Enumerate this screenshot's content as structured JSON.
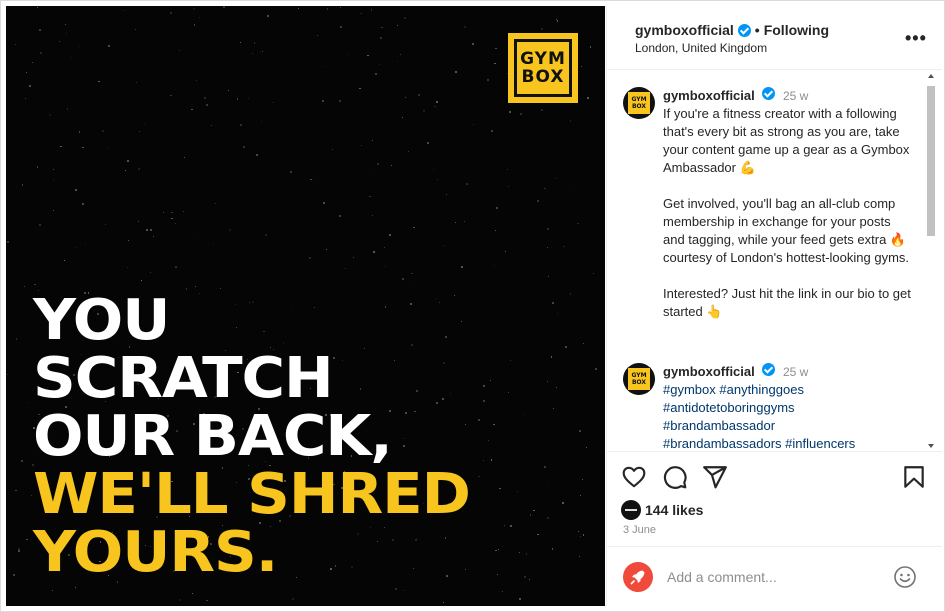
{
  "post": {
    "username": "gymboxofficial",
    "follow_status": "Following",
    "separator": "•",
    "location": "London, United Kingdom",
    "more_icon": "more-horizontal-icon",
    "more_glyph": "•••"
  },
  "media": {
    "logo_line1": "GYM",
    "logo_line2": "BOX",
    "headline": [
      "YOU",
      "SCRATCH",
      "OUR BACK,",
      "WE'LL SHRED",
      "YOURS."
    ],
    "colors": {
      "background": "#050505",
      "accent": "#f7c51e",
      "text": "#ffffff"
    }
  },
  "caption": {
    "username": "gymboxofficial",
    "time": "25 w",
    "text": "If you're a fitness creator with a following that's every bit as strong as you are, take your content game up a gear as a Gymbox Ambassador 💪\n\nGet involved, you'll bag an all-club comp membership in exchange for your posts and tagging, while your feed gets extra 🔥 courtesy of London's hottest-looking gyms.\n\nInterested? Just hit the link in our bio to get started 👆"
  },
  "hashtag_comment": {
    "username": "gymboxofficial",
    "time": "25 w",
    "tags": [
      "#gymbox",
      "#anythinggoes",
      "#antidotetoboringgyms",
      "#brandambassador",
      "#brandambassadors",
      "#influencers"
    ]
  },
  "avatar": {
    "line1": "GYM",
    "line2": "BOX"
  },
  "actions": {
    "icons": [
      "heart-icon",
      "comment-icon",
      "share-icon",
      "bookmark-icon"
    ],
    "likes": "144 likes",
    "date": "3 June"
  },
  "composer": {
    "placeholder": "Add a comment...",
    "icon": "emoji-icon"
  }
}
